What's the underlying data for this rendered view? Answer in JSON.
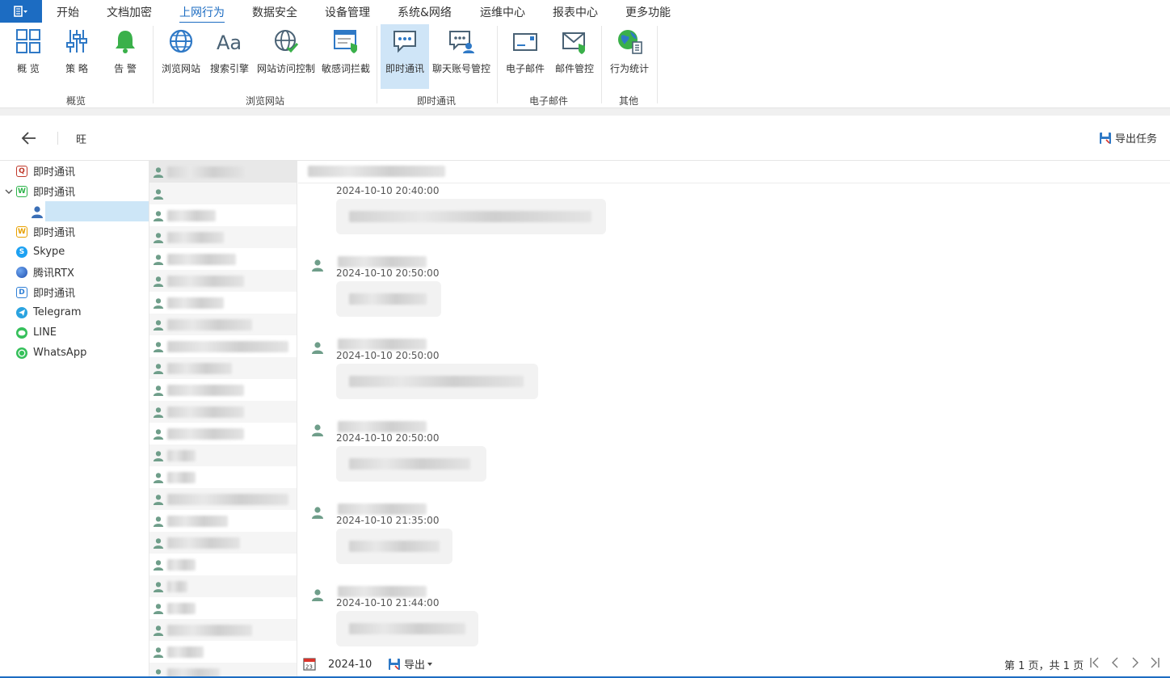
{
  "menu": {
    "app_icon": "menu-grid-icon",
    "items": [
      "开始",
      "文档加密",
      "上网行为",
      "数据安全",
      "设备管理",
      "系统&网络",
      "运维中心",
      "报表中心",
      "更多功能"
    ],
    "active_index": 2
  },
  "ribbon": {
    "buttons": [
      {
        "label": "概 览",
        "icon": "dashboard-icon"
      },
      {
        "label": "策 略",
        "icon": "policy-sliders-icon"
      },
      {
        "label": "告 警",
        "icon": "alarm-bell-icon"
      },
      {
        "label": "浏览网站",
        "icon": "globe-icon"
      },
      {
        "label": "搜索引擎",
        "icon": "search-engine-aa-icon"
      },
      {
        "label": "网站访问控制",
        "icon": "globe-check-icon"
      },
      {
        "label": "敏感词拦截",
        "icon": "sensitive-word-icon"
      },
      {
        "label": "即时通讯",
        "icon": "chat-bubble-icon"
      },
      {
        "label": "聊天账号管控",
        "icon": "chat-account-icon"
      },
      {
        "label": "电子邮件",
        "icon": "email-icon"
      },
      {
        "label": "邮件管控",
        "icon": "email-control-icon"
      },
      {
        "label": "行为统计",
        "icon": "behavior-stats-icon"
      }
    ],
    "groups": [
      "概览",
      "浏览网站",
      "即时通讯",
      "电子邮件",
      "其他"
    ]
  },
  "toolbar": {
    "title": "旺",
    "export_task": "导出任务"
  },
  "tree": {
    "items": [
      {
        "label": "即时通讯",
        "icon": "qq-icon",
        "color": "#c0392b"
      },
      {
        "label": "即时通讯",
        "icon": "wechat-icon",
        "color": "#2db34a",
        "expanded": true
      },
      {
        "label": "",
        "icon": "person-icon",
        "color": "#3b6fb6",
        "selected": true
      },
      {
        "label": "即时通讯",
        "icon": "wangwang-icon",
        "color": "#e8a100"
      },
      {
        "label": "Skype",
        "icon": "skype-icon",
        "color": "#1da1f2"
      },
      {
        "label": "腾讯RTX",
        "icon": "rtx-icon",
        "color": "#2f6fd6"
      },
      {
        "label": "即时通讯",
        "icon": "dingtalk-icon",
        "color": "#2f7fd6"
      },
      {
        "label": "Telegram",
        "icon": "telegram-icon",
        "color": "#2aa3e0"
      },
      {
        "label": "LINE",
        "icon": "line-icon",
        "color": "#36c05b"
      },
      {
        "label": "WhatsApp",
        "icon": "whatsapp-icon",
        "color": "#36c05b"
      }
    ]
  },
  "contacts": {
    "count": 24
  },
  "chat": {
    "messages": [
      {
        "time": "2024-10-10 20:40:00",
        "has_name": false
      },
      {
        "time": "2024-10-10 20:50:00",
        "has_name": true
      },
      {
        "time": "2024-10-10 20:50:00",
        "has_name": true
      },
      {
        "time": "2024-10-10 20:50:00",
        "has_name": true
      },
      {
        "time": "2024-10-10 21:35:00",
        "has_name": true
      },
      {
        "time": "2024-10-10 21:44:00",
        "has_name": true
      }
    ]
  },
  "footer": {
    "date": "2024-10",
    "export_label": "导出",
    "page_info": "第 1 页，共 1 页"
  },
  "colors": {
    "accent": "#1c6cc2",
    "selected_bg": "#cde6f7",
    "avatar_green": "#6f9e8a"
  }
}
